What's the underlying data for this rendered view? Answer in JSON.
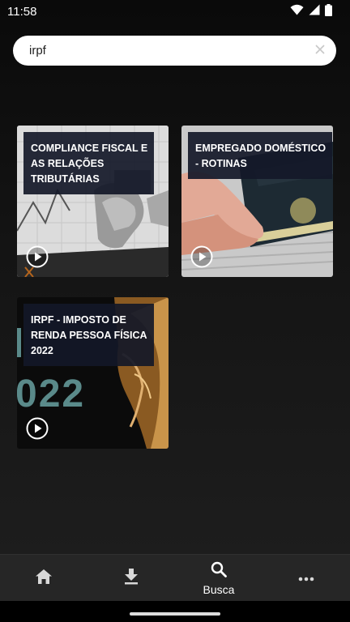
{
  "status_bar": {
    "time": "11:58",
    "icons": [
      "wifi-icon",
      "cellular-signal-icon",
      "battery-icon"
    ]
  },
  "search": {
    "value": "irpf",
    "placeholder": ""
  },
  "results": [
    {
      "title_line1": "COMPLIANCE FISCAL E",
      "title_line2": "AS RELAÇÕES",
      "title_line3": "TRIBUTÁRIAS",
      "icon": "play-icon"
    },
    {
      "title_line1": "EMPREGADO DOMÉSTICO",
      "title_line2": "- ROTINAS",
      "icon": "play-icon"
    },
    {
      "title_line1": "IRPF - IMPOSTO DE",
      "title_line2": "RENDA PESSOA FÍSICA",
      "title_line3": "2022",
      "thumb_text": "022",
      "icon": "play-icon"
    }
  ],
  "bottom_nav": {
    "items": [
      {
        "icon": "home-icon",
        "label": ""
      },
      {
        "icon": "download-icon",
        "label": ""
      },
      {
        "icon": "search-icon",
        "label": "Busca",
        "active": true
      },
      {
        "icon": "more-icon",
        "label": ""
      }
    ]
  },
  "colors": {
    "background": "#111111",
    "nav_background": "#262626",
    "title_box": "#141828",
    "accent_teal": "#5a8a8a"
  }
}
